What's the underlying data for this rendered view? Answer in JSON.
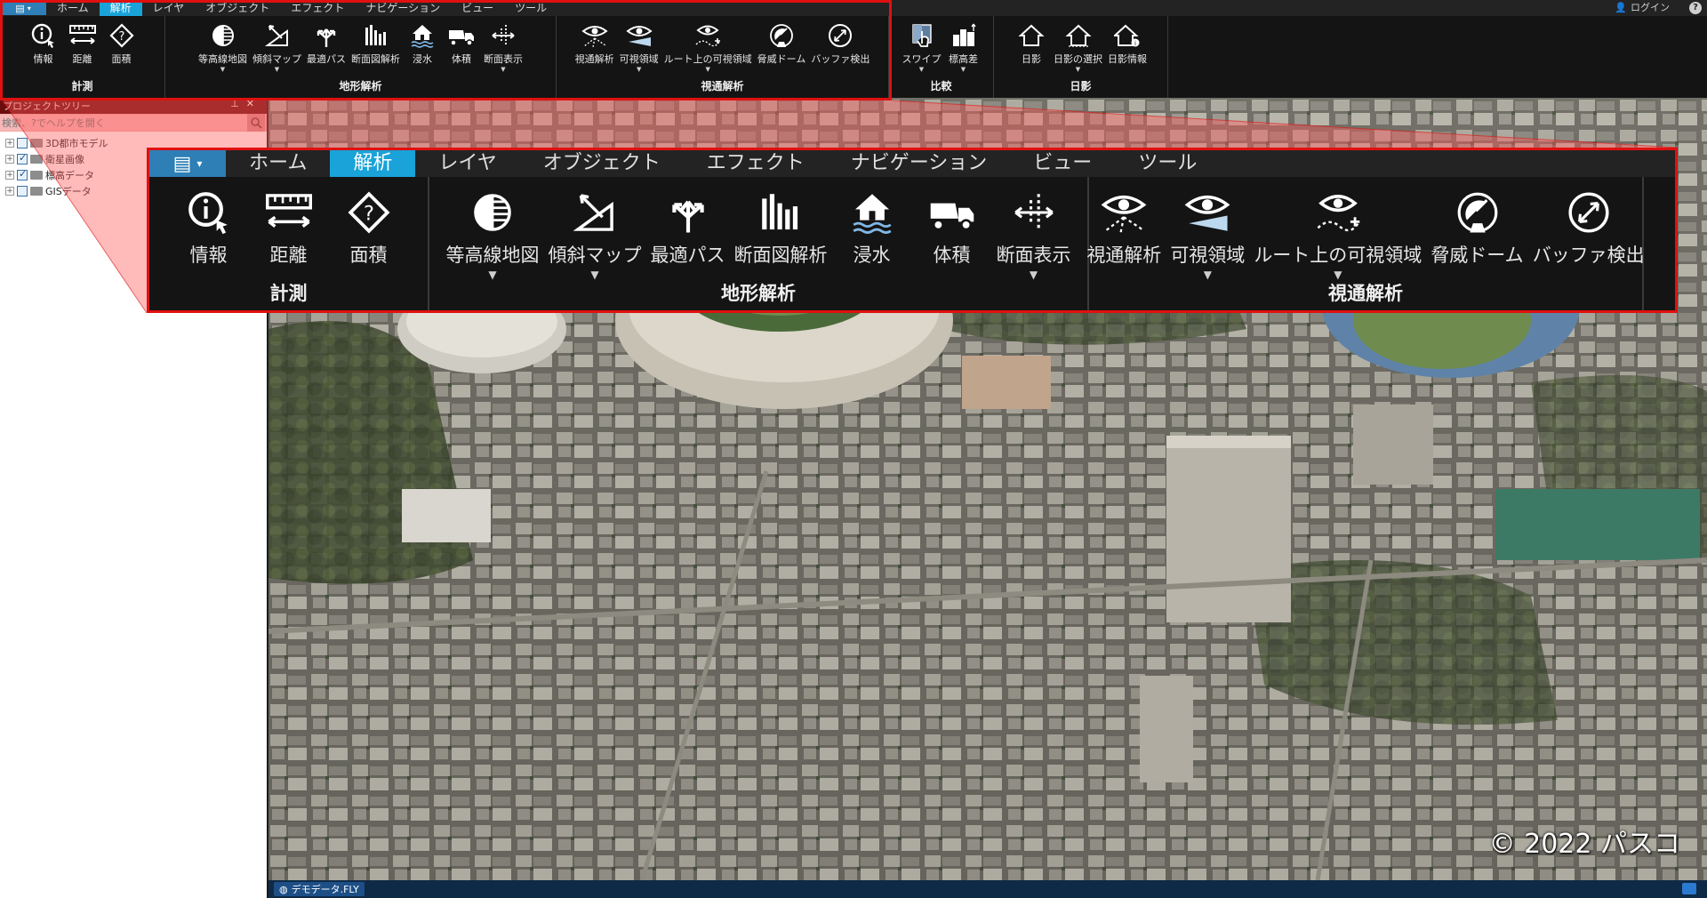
{
  "menu": {
    "tabs": [
      "ホーム",
      "解析",
      "レイヤ",
      "オブジェクト",
      "エフェクト",
      "ナビゲーション",
      "ビュー",
      "ツール"
    ],
    "active_tab": "解析",
    "login": "ログイン"
  },
  "ribbon": {
    "measure": {
      "title": "計測",
      "tools": [
        "情報",
        "距離",
        "面積"
      ]
    },
    "terrain": {
      "title": "地形解析",
      "tools": [
        "等高線地図",
        "傾斜マップ",
        "最適パス",
        "断面図解析",
        "浸水",
        "体積",
        "断面表示"
      ]
    },
    "visibility": {
      "title": "視通解析",
      "tools": [
        "視通解析",
        "可視領域",
        "ルート上の可視領域",
        "脅威ドーム",
        "バッファ検出"
      ]
    },
    "compare": {
      "title": "比較",
      "tools": [
        "スワイプ",
        "標高差"
      ]
    },
    "shadow": {
      "title": "日影",
      "tools": [
        "日影",
        "日影の選択",
        "日影情報"
      ]
    }
  },
  "project_tree": {
    "title": "プロジェクトツリー",
    "search_placeholder": "検索、?でヘルプを開く",
    "items": [
      {
        "label": "3D都市モデル",
        "checked": false
      },
      {
        "label": "衛星画像",
        "checked": true
      },
      {
        "label": "標高データ",
        "checked": true
      },
      {
        "label": "GISデータ",
        "checked": false
      }
    ]
  },
  "viewport": {
    "copyright": "© 2022 パスコ"
  },
  "statusbar": {
    "document": "デモデータ.FLY"
  },
  "colors": {
    "accent_tab": "#19a3d9",
    "file_button": "#2d7fb6",
    "highlight": "#e01010",
    "ribbon_bg": "#141414"
  }
}
